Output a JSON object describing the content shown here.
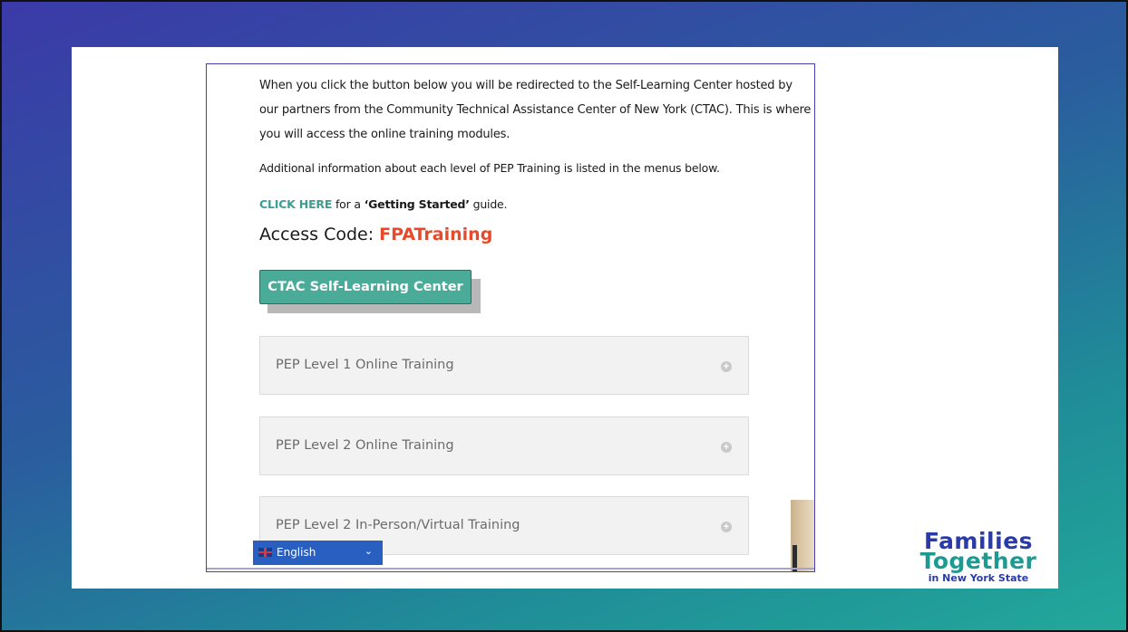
{
  "content": {
    "intro_paragraph": "When you click the button below you will be redirected to the Self-Learning Center hosted by our partners from the Community Technical Assistance Center of New York (CTAC). This is where you will access the online training modules.",
    "additional_info": "Additional information about each level of PEP Training is listed in the menus below.",
    "getting_started": {
      "link_label": "CLICK HERE",
      "text_before": "for a ",
      "guide_label": "‘Getting Started’",
      "text_after": " guide."
    },
    "access_code": {
      "label": "Access Code: ",
      "code": "FPATraining"
    },
    "cta_button_label": "CTAC Self-Learning Center"
  },
  "accordion": [
    {
      "title": "PEP Level 1 Online Training"
    },
    {
      "title": "PEP Level 2 Online Training"
    },
    {
      "title": "PEP Level 2 In-Person/Virtual Training"
    }
  ],
  "language_selector": {
    "selected": "English",
    "flag_icon": "uk-flag-icon",
    "chevron_icon": "chevron-down-icon"
  },
  "logo": {
    "line1": "Families",
    "line2": "Together",
    "line3": "in New York State"
  },
  "colors": {
    "link": "#3a9e93",
    "access_code": "#e8492b",
    "button": "#4aab98",
    "language_bar": "#2a5fc2"
  }
}
